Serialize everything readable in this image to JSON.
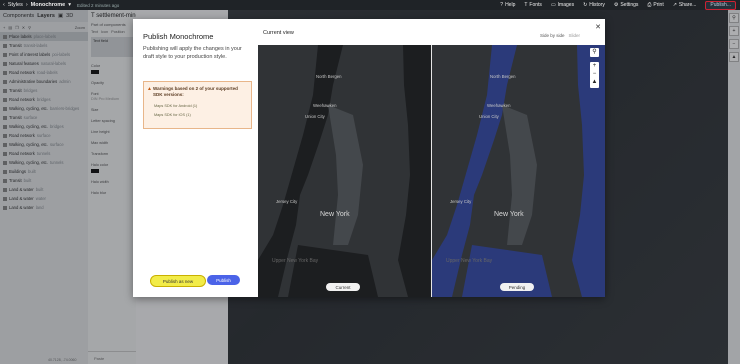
{
  "topbar": {
    "crumb_styles": "Styles",
    "crumb_style": "Monochrome",
    "saved": "Edited 2 minutes ago",
    "menu": [
      "Help",
      "Fonts",
      "Images",
      "History",
      "Settings",
      "Print",
      "Share...",
      "Publish..."
    ]
  },
  "left_panel": {
    "tab_components": "Components",
    "tab_layers": "Layers",
    "tab_3d": "3D",
    "tools_label": "Zoom",
    "layers": [
      {
        "name": "Place labels",
        "sub": "place-labels"
      },
      {
        "name": "Transit",
        "sub": "transit-labels"
      },
      {
        "name": "Point of interest labels",
        "sub": "poi-labels"
      },
      {
        "name": "Natural features",
        "sub": "natural-labels"
      },
      {
        "name": "Road network",
        "sub": "road-labels"
      },
      {
        "name": "Administrative boundaries",
        "sub": "admin"
      },
      {
        "name": "Transit",
        "sub": "bridges"
      },
      {
        "name": "Road network",
        "sub": "bridges"
      },
      {
        "name": "Walking, cycling, etc.",
        "sub": "barriers-bridges"
      },
      {
        "name": "Transit",
        "sub": "surface"
      },
      {
        "name": "Walking, cycling, etc.",
        "sub": "bridges"
      },
      {
        "name": "Road network",
        "sub": "surface"
      },
      {
        "name": "Walking, cycling, etc.",
        "sub": "surface"
      },
      {
        "name": "Road network",
        "sub": "tunnels"
      },
      {
        "name": "Walking, cycling, etc.",
        "sub": "tunnels"
      },
      {
        "name": "Buildings",
        "sub": "built"
      },
      {
        "name": "Transit",
        "sub": "built"
      },
      {
        "name": "Land & water",
        "sub": "built"
      },
      {
        "name": "Land & water",
        "sub": "water"
      },
      {
        "name": "Land & water",
        "sub": "land"
      }
    ],
    "footer": "40.7128, -74.0060"
  },
  "mid_panel": {
    "title": "T settlement-minor-label",
    "subtitle": "Part of components",
    "tabs": [
      "Text",
      "Icon",
      "Position"
    ],
    "selected": "Text field",
    "props": [
      "Color",
      "Opacity",
      "Font",
      "Size",
      "Letter spacing",
      "Line height",
      "Max width",
      "Transform",
      "Halo color",
      "Halo width",
      "Halo blur"
    ],
    "font_value": "DIN Pro Medium",
    "footer": "Paste"
  },
  "modal": {
    "title": "Publish Monochrome",
    "description": "Publishing will apply the changes in your draft style to your production style.",
    "warning_title": "Warnings based on 2 of your supported SDK versions:",
    "warnings": [
      "Maps SDK for Android (1)",
      "Maps SDK for iOS (1)"
    ],
    "btn_publish_new": "Publish as new",
    "btn_publish": "Publish",
    "current_view": "Current view",
    "tab_side": "Side by side",
    "tab_slider": "Slider",
    "pill_current": "Current",
    "pill_pending": "Pending",
    "map_labels": {
      "north_bergen": "North Bergen",
      "weehawken": "Weehawken",
      "union_city": "Union City",
      "jersey_city": "Jersey City",
      "new_york": "New York",
      "upper_bay": "Upper New York Bay"
    }
  },
  "colors": {
    "water_current": "#1c1e20",
    "water_pending": "#2b3a7a",
    "land": "#303336",
    "publish_button": "#4b63e8",
    "highlight": "#f2ec48"
  }
}
